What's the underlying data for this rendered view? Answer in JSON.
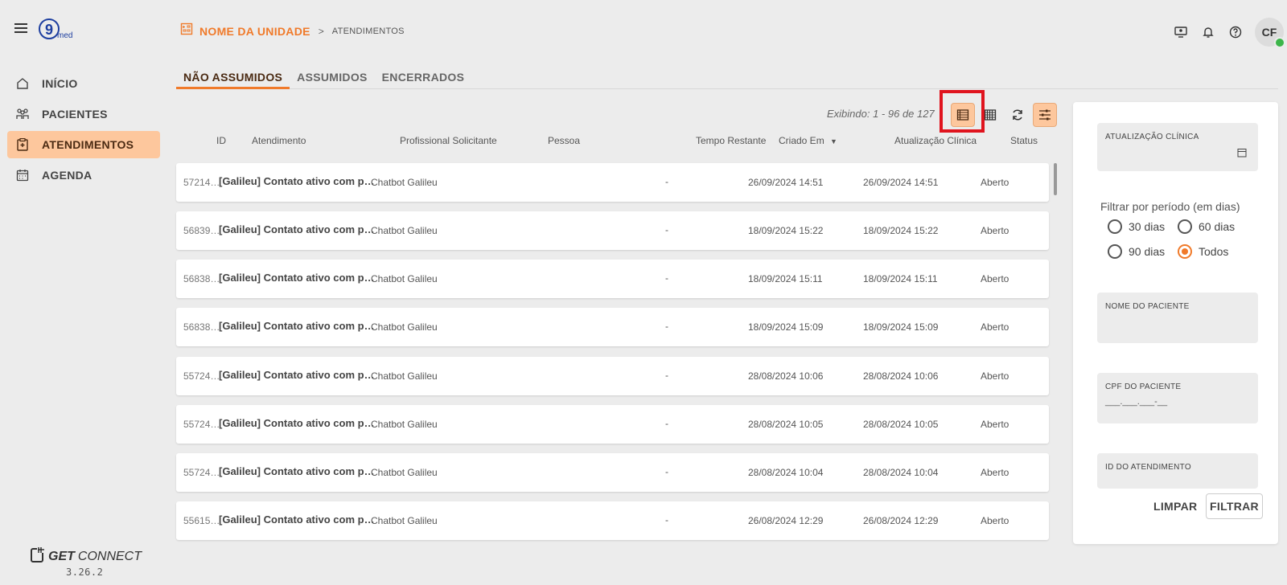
{
  "app": {
    "version": "3.26.2",
    "brand": {
      "get": "GET",
      "connect": "CONNECT"
    }
  },
  "sidebar": {
    "items": [
      {
        "label": "INÍCIO",
        "icon": "home-icon"
      },
      {
        "label": "PACIENTES",
        "icon": "patients-icon"
      },
      {
        "label": "ATENDIMENTOS",
        "icon": "clipboard-icon",
        "active": true
      },
      {
        "label": "AGENDA",
        "icon": "calendar-icon"
      }
    ]
  },
  "header": {
    "unit_name": "NOME DA UNIDADE",
    "separator": ">",
    "page": "ATENDIMENTOS",
    "avatar_initials": "CF"
  },
  "tabs": [
    "NÃO ASSUMIDOS",
    "ASSUMIDOS",
    "ENCERRADOS"
  ],
  "toolbar": {
    "showing": "Exibindo: 1 - 96 de 127"
  },
  "table": {
    "columns": [
      "ID",
      "Atendimento",
      "Profissional Solicitante",
      "Pessoa",
      "Tempo Restante",
      "Criado Em",
      "Atualização Clínica",
      "Status"
    ],
    "rows": [
      {
        "id": "57214…",
        "title": "[Galileu] Contato ativo com p…",
        "professional": "Chatbot Galileu",
        "time_left": "-",
        "created": "26/09/2024 14:51",
        "updated": "26/09/2024 14:51",
        "status": "Aberto"
      },
      {
        "id": "56839…",
        "title": "[Galileu] Contato ativo com p…",
        "professional": "Chatbot Galileu",
        "time_left": "-",
        "created": "18/09/2024 15:22",
        "updated": "18/09/2024 15:22",
        "status": "Aberto"
      },
      {
        "id": "56838…",
        "title": "[Galileu] Contato ativo com p…",
        "professional": "Chatbot Galileu",
        "time_left": "-",
        "created": "18/09/2024 15:11",
        "updated": "18/09/2024 15:11",
        "status": "Aberto"
      },
      {
        "id": "56838…",
        "title": "[Galileu] Contato ativo com p…",
        "professional": "Chatbot Galileu",
        "time_left": "-",
        "created": "18/09/2024 15:09",
        "updated": "18/09/2024 15:09",
        "status": "Aberto"
      },
      {
        "id": "55724…",
        "title": "[Galileu] Contato ativo com p…",
        "professional": "Chatbot Galileu",
        "time_left": "-",
        "created": "28/08/2024 10:06",
        "updated": "28/08/2024 10:06",
        "status": "Aberto"
      },
      {
        "id": "55724…",
        "title": "[Galileu] Contato ativo com p…",
        "professional": "Chatbot Galileu",
        "time_left": "-",
        "created": "28/08/2024 10:05",
        "updated": "28/08/2024 10:05",
        "status": "Aberto"
      },
      {
        "id": "55724…",
        "title": "[Galileu] Contato ativo com p…",
        "professional": "Chatbot Galileu",
        "time_left": "-",
        "created": "28/08/2024 10:04",
        "updated": "28/08/2024 10:04",
        "status": "Aberto"
      },
      {
        "id": "55615…",
        "title": "[Galileu] Contato ativo com p…",
        "professional": "Chatbot Galileu",
        "time_left": "-",
        "created": "26/08/2024 12:29",
        "updated": "26/08/2024 12:29",
        "status": "Aberto"
      }
    ]
  },
  "filters": {
    "clinical_update_label": "ATUALIZAÇÃO CLÍNICA",
    "period_label": "Filtrar por período (em dias)",
    "periods": [
      {
        "label": "30 dias",
        "selected": false
      },
      {
        "label": "60 dias",
        "selected": false
      },
      {
        "label": "90 dias",
        "selected": false
      },
      {
        "label": "Todos",
        "selected": true
      }
    ],
    "patient_name_label": "NOME DO PACIENTE",
    "cpf_label": "CPF DO PACIENTE",
    "cpf_placeholder": "___.___.___-__",
    "id_label": "ID DO ATENDIMENTO",
    "clear_label": "LIMPAR",
    "filter_label": "FILTRAR"
  },
  "colors": {
    "accent": "#f07a2a",
    "active_bg": "#fdc79d",
    "highlight": "#e0141e"
  }
}
